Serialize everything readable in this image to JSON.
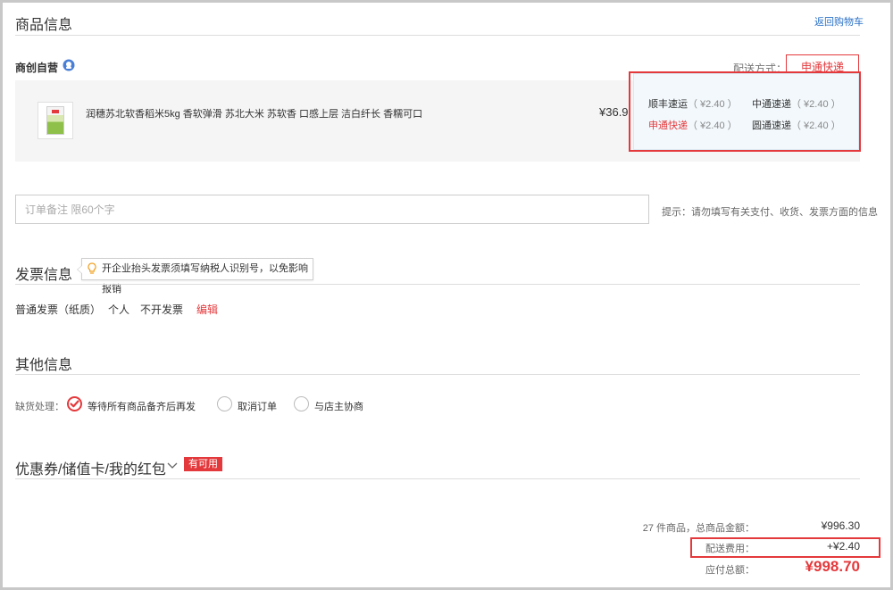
{
  "goods": {
    "title": "商品信息",
    "back_link": "返回购物车",
    "shop_name": "商创自营",
    "shipping_label": "配送方式：",
    "shipping_selected": "申通快递",
    "product_name": "润穗苏北软香稻米5kg 香软弹滑 苏北大米 苏软香 口感上层 洁白纤长 香糯可口",
    "product_price": "¥36.9",
    "shipping_options": [
      {
        "name": "顺丰速运",
        "fee": "（ ¥2.40 ）",
        "selected": false
      },
      {
        "name": "中通速递",
        "fee": "（ ¥2.40 ）",
        "selected": false
      },
      {
        "name": "申通快递",
        "fee": "（ ¥2.40 ）",
        "selected": true
      },
      {
        "name": "圆通速递",
        "fee": "（ ¥2.40 ）",
        "selected": false
      }
    ]
  },
  "remark": {
    "placeholder": "订单备注 限60个字",
    "hint": "提示：请勿填写有关支付、收货、发票方面的信息"
  },
  "invoice": {
    "title": "发票信息",
    "tip": "开企业抬头发票须填写纳税人识别号，以免影响报销",
    "type": "普通发票（纸质）",
    "header": "个人",
    "content": "不开发票",
    "edit": "编辑"
  },
  "other": {
    "title": "其他信息",
    "stockout_label": "缺货处理：",
    "options": [
      {
        "label": "等待所有商品备齐后再发",
        "checked": true
      },
      {
        "label": "取消订单",
        "checked": false
      },
      {
        "label": "与店主协商",
        "checked": false
      }
    ]
  },
  "coupon": {
    "title": "优惠券/储值卡/我的红包",
    "badge": "有可用"
  },
  "summary": {
    "goods_total_label": "27 件商品，总商品金额：",
    "goods_total": "¥996.30",
    "shipping_fee_label": "配送费用：",
    "shipping_fee": "+¥2.40",
    "payable_label": "应付总额：",
    "payable": "¥998.70"
  },
  "colors": {
    "accent": "#e4393c",
    "link": "#2a71c7",
    "popup_bg": "#f2f8fc"
  }
}
